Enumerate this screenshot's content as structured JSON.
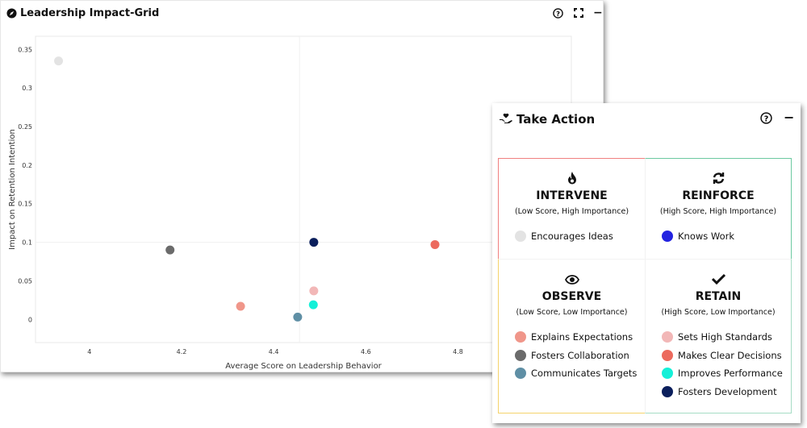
{
  "chart_window": {
    "title": "Leadership Impact-Grid",
    "icons": [
      "compass-icon",
      "help-icon",
      "fullscreen-icon",
      "minimize-icon"
    ]
  },
  "chart_data": {
    "type": "scatter",
    "xlabel": "Average Score on Leadership Behavior",
    "ylabel": "Impact on Retention Intention",
    "xlim": [
      3.883,
      5.046
    ],
    "ylim": [
      -0.03,
      0.367
    ],
    "xticks": [
      4,
      4.2,
      4.4,
      4.6,
      4.8
    ],
    "xtick_labels": [
      "4",
      "4.2",
      "4.4",
      "4.6",
      "4.8"
    ],
    "yticks": [
      0,
      0.05,
      0.1,
      0.15,
      0.2,
      0.25,
      0.3,
      0.35
    ],
    "ytick_labels": [
      "0",
      "0.05",
      "0.1",
      "0.15",
      "0.2",
      "0.25",
      "0.3",
      "0.35"
    ],
    "quadrant_lines": {
      "x": 4.456,
      "y": 0.1
    },
    "grid": false,
    "points": [
      {
        "name": "Encourages Ideas",
        "x": 3.933,
        "y": 0.335,
        "color": "#e3e3e3"
      },
      {
        "name": "Fosters Collaboration",
        "x": 4.175,
        "y": 0.09,
        "color": "#6b6b6b"
      },
      {
        "name": "Explains Expectations",
        "x": 4.328,
        "y": 0.017,
        "color": "#f0968a"
      },
      {
        "name": "Communicates Targets",
        "x": 4.452,
        "y": 0.003,
        "color": "#5f8fa5"
      },
      {
        "name": "Improves Performance",
        "x": 4.486,
        "y": 0.019,
        "color": "#14f0d8"
      },
      {
        "name": "Sets High Standards",
        "x": 4.487,
        "y": 0.037,
        "color": "#f2b7b7"
      },
      {
        "name": "Fosters Development",
        "x": 4.487,
        "y": 0.1,
        "color": "#0b1f5c"
      },
      {
        "name": "Makes Clear Decisions",
        "x": 4.75,
        "y": 0.097,
        "color": "#ec6a5e"
      }
    ]
  },
  "action_window": {
    "title": "Take Action",
    "quadrants": [
      {
        "title": "INTERVENE",
        "subtitle": "(Low Score, High Importance)",
        "icon": "flame-icon",
        "border": "#f08080",
        "items": [
          {
            "label": "Encourages Ideas",
            "color": "#e3e3e3"
          }
        ]
      },
      {
        "title": "REINFORCE",
        "subtitle": "(High Score, High Importance)",
        "icon": "sync-icon",
        "border": "#6cc9a0",
        "items": [
          {
            "label": "Knows Work",
            "color": "#2323e0"
          }
        ]
      },
      {
        "title": "OBSERVE",
        "subtitle": "(Low Score, Low Importance)",
        "icon": "eye-icon",
        "border": "#f5d36b",
        "items": [
          {
            "label": "Explains Expectations",
            "color": "#f0968a"
          },
          {
            "label": "Fosters Collaboration",
            "color": "#6b6b6b"
          },
          {
            "label": "Communicates Targets",
            "color": "#5f8fa5"
          }
        ]
      },
      {
        "title": "RETAIN",
        "subtitle": "(High Score, Low Importance)",
        "icon": "check-icon",
        "border": "#a6dcc4",
        "items": [
          {
            "label": "Sets High Standards",
            "color": "#f2b7b7"
          },
          {
            "label": "Makes Clear Decisions",
            "color": "#ec6a5e"
          },
          {
            "label": "Improves Performance",
            "color": "#14f0d8"
          },
          {
            "label": "Fosters Development",
            "color": "#0b1f5c"
          }
        ]
      }
    ]
  }
}
